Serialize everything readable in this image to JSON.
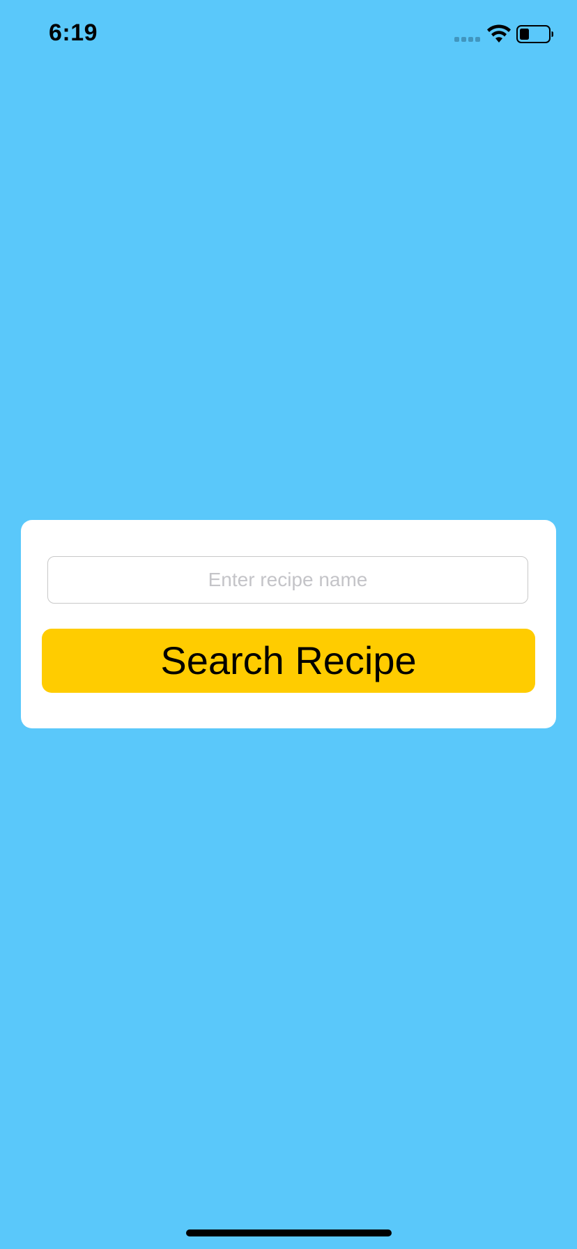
{
  "status_bar": {
    "time": "6:19",
    "signal_icon": "cellular-signal-icon",
    "wifi_icon": "wifi-icon",
    "battery_icon": "battery-icon",
    "battery_level": 0.3
  },
  "search_card": {
    "input": {
      "value": "",
      "placeholder": "Enter recipe name"
    },
    "button_label": "Search Recipe"
  },
  "colors": {
    "background": "#5ac8fa",
    "card": "#ffffff",
    "button": "#ffcc00"
  }
}
